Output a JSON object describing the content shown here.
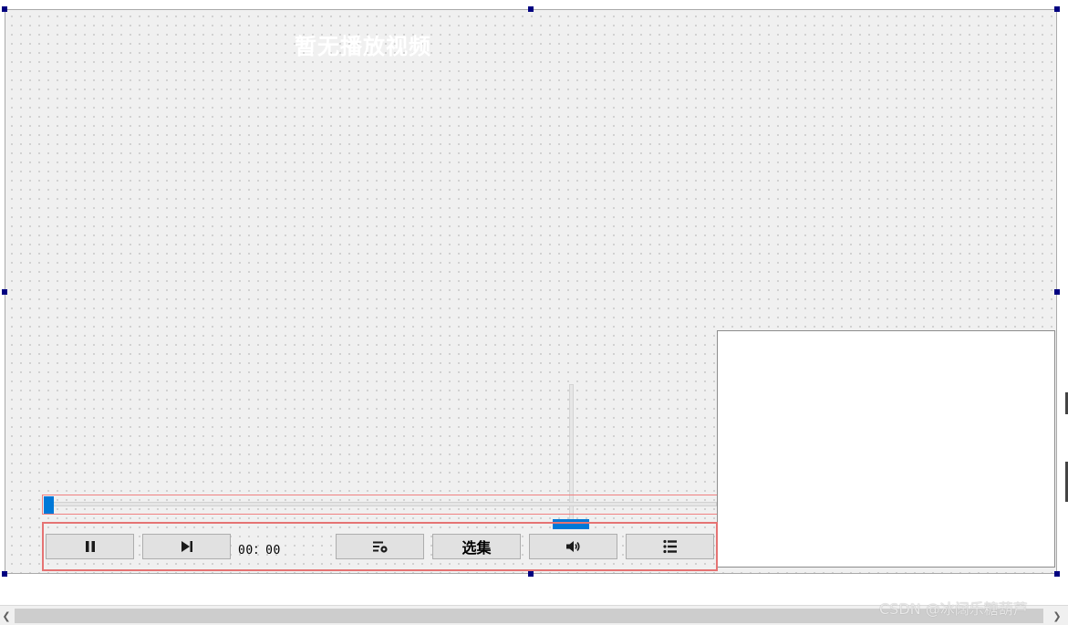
{
  "video": {
    "placeholder_title": "暂无播放视频"
  },
  "controls": {
    "pause_icon": "pause-icon",
    "next_icon": "skip-next-icon",
    "time_display": "00：00",
    "playback_settings_icon": "playlist-settings-icon",
    "episodes_label": "选集",
    "volume_icon": "volume-icon",
    "playlist_icon": "list-icon"
  },
  "progress": {
    "value": 0
  },
  "volume": {
    "value": 0
  },
  "watermark": {
    "text": "CSDN @冰阔乐糖葫芦"
  },
  "colors": {
    "accent": "#0078d7",
    "frame_highlight": "#e57373",
    "canvas_background": "#f0f0f0",
    "selection_handle": "#000080"
  }
}
